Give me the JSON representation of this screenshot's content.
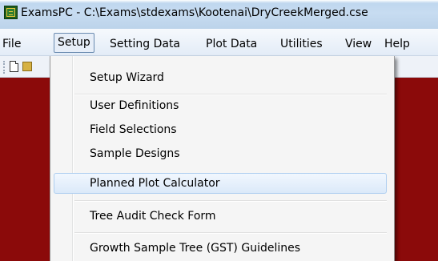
{
  "window": {
    "title": "ExamsPC - C:\\Exams\\stdexams\\Kootenai\\DryCreekMerged.cse"
  },
  "menubar": {
    "items": [
      "File",
      "Setup",
      "Setting Data",
      "Plot Data",
      "Utilities",
      "View",
      "Help"
    ],
    "active": "Setup"
  },
  "toolbar": {
    "icons": [
      "new-document-icon",
      "open-folder-icon"
    ]
  },
  "dropdown": {
    "items": [
      "Setup Wizard",
      "User Definitions",
      "Field Selections",
      "Sample Designs",
      "Planned Plot Calculator",
      "Tree Audit Check Form",
      "Growth Sample Tree (GST) Guidelines"
    ],
    "highlighted": "Planned Plot Calculator"
  },
  "colors": {
    "content_background": "#8b0a0a",
    "titlebar": "#c4d9ef",
    "menu_background": "#f5f5f5",
    "highlight": "#dbe9f9"
  }
}
